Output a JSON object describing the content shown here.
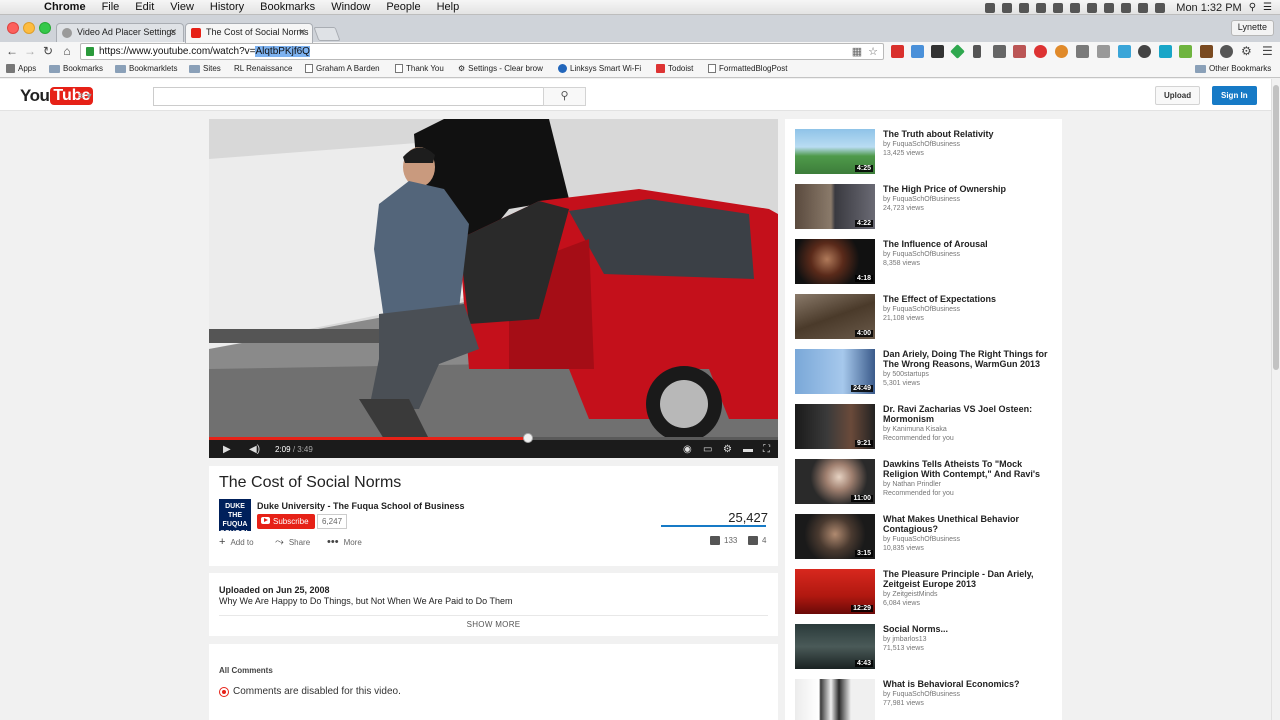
{
  "menubar": {
    "items": [
      "Chrome",
      "File",
      "Edit",
      "View",
      "History",
      "Bookmarks",
      "Window",
      "People",
      "Help"
    ],
    "clock": "Mon 1:32 PM"
  },
  "tabs": [
    {
      "title": "Video Ad Placer Settings",
      "active": false
    },
    {
      "title": "The Cost of Social Norms",
      "active": true
    }
  ],
  "profile": "Lynette",
  "address": {
    "prefix": "https://www.youtube.com/watch?v=",
    "selected": "AlqtbPKjf6Q"
  },
  "bookmarks": [
    "Apps",
    "Bookmarks",
    "Bookmarklets",
    "Sites",
    "RL  Renaissance",
    "Graham A Barden",
    "Thank You",
    "Settings - Clear brow",
    "Linksys Smart Wi-Fi",
    "Todoist",
    "FormattedBlogPost",
    "Other Bookmarks"
  ],
  "youtube": {
    "logo_you": "You",
    "logo_tube": "Tube",
    "search_icon": "⚲",
    "upload": "Upload",
    "signin": "Sign In"
  },
  "player": {
    "current_time": "2:09",
    "duration": "/ 3:49",
    "progress_fraction": 0.56
  },
  "video": {
    "title": "The Cost of Social Norms",
    "channel": "Duke University - The Fuqua School of Business",
    "channel_logo": "DUKE THE FUQUA SCHOOL OF BUSINESS",
    "subscribe": "Subscribe",
    "subscribers": "6,247",
    "views": "25,427",
    "add_to": "Add to",
    "share": "Share",
    "more": "More",
    "likes": "133",
    "dislikes": "4",
    "uploaded": "Uploaded on Jun 25, 2008",
    "description": "Why We Are Happy to Do Things, but Not When We Are Paid to Do Them",
    "show_more": "SHOW MORE",
    "all_comments": "All Comments",
    "comments_disabled": "Comments are disabled for this video."
  },
  "related": [
    {
      "title": "The Truth about Relativity",
      "by": "by FuquaSchOfBusiness",
      "meta": "13,425 views",
      "duration": "4:25"
    },
    {
      "title": "The High Price of Ownership",
      "by": "by FuquaSchOfBusiness",
      "meta": "24,723 views",
      "duration": "4:22"
    },
    {
      "title": "The Influence of Arousal",
      "by": "by FuquaSchOfBusiness",
      "meta": "8,358 views",
      "duration": "4:18"
    },
    {
      "title": "The Effect of Expectations",
      "by": "by FuquaSchOfBusiness",
      "meta": "21,108 views",
      "duration": "4:00"
    },
    {
      "title": "Dan Ariely, Doing The Right Things for The Wrong Reasons, WarmGun 2013",
      "by": "by 500startups",
      "meta": "5,301 views",
      "duration": "24:49"
    },
    {
      "title": "Dr. Ravi Zacharias VS Joel Osteen: Mormonism",
      "by": "by Kanimuna Kisaka",
      "meta": "Recommended for you",
      "duration": "9:21"
    },
    {
      "title": "Dawkins Tells Atheists To \"Mock Religion With Contempt,\" And Ravi's",
      "by": "by Nathan Prindler",
      "meta": "Recommended for you",
      "duration": "11:00"
    },
    {
      "title": "What Makes Unethical Behavior Contagious?",
      "by": "by FuquaSchOfBusiness",
      "meta": "10,835 views",
      "duration": "3:15"
    },
    {
      "title": "The Pleasure Principle - Dan Ariely, Zeitgeist Europe 2013",
      "by": "by ZeitgeistMinds",
      "meta": "6,084 views",
      "duration": "12:29"
    },
    {
      "title": "Social Norms...",
      "by": "by jmbarlos13",
      "meta": "71,513 views",
      "duration": "4:43"
    },
    {
      "title": "What is Behavioral Economics?",
      "by": "by FuquaSchOfBusiness",
      "meta": "77,981 views",
      "duration": ""
    }
  ]
}
